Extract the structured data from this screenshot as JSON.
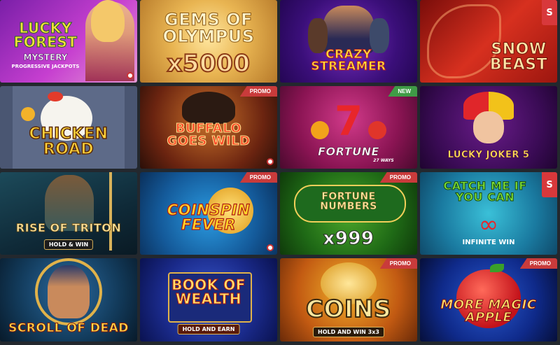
{
  "tiles": [
    {
      "title": "LUCKY FOREST",
      "subtitle": "MYSTERY",
      "tag": "PROGRESSIVE JACKPOTS"
    },
    {
      "title": "GEMS OF OLYMPUS",
      "subtitle": "x5000"
    },
    {
      "title": "CRAZY STREAMER"
    },
    {
      "title": "SNOW BEAST",
      "provider": "S"
    },
    {
      "title": "CHICKEN ROAD"
    },
    {
      "title": "BUFFALO GOES WILD",
      "badge": "PROMO"
    },
    {
      "title": "FORTUNE",
      "subtitle": "27 WAYS",
      "badge": "NEW"
    },
    {
      "title": "LUCKY JOKER 5"
    },
    {
      "title": "RISE OF TRITON",
      "tag": "HOLD & WIN"
    },
    {
      "title": "COINSPIN FEVER",
      "badge": "PROMO"
    },
    {
      "title": "FORTUNE NUMBERS",
      "subtitle": "x999",
      "badge": "PROMO"
    },
    {
      "title": "CATCH ME IF YOU CAN",
      "tag": "INFINITE WIN",
      "provider": "S"
    },
    {
      "title": "SCROLL OF DEAD"
    },
    {
      "title": "BOOK OF WEALTH",
      "tag": "HOLD AND EARN"
    },
    {
      "title": "COINS",
      "tag": "HOLD AND WIN 3x3",
      "badge": "PROMO"
    },
    {
      "title": "MORE MAGIC APPLE",
      "badge": "PROMO"
    }
  ],
  "colors": {
    "page_bg": "#23282e",
    "promo_badge": "#c93b3b",
    "new_badge": "#3f9b46",
    "provider_badge": "#d8383b"
  }
}
